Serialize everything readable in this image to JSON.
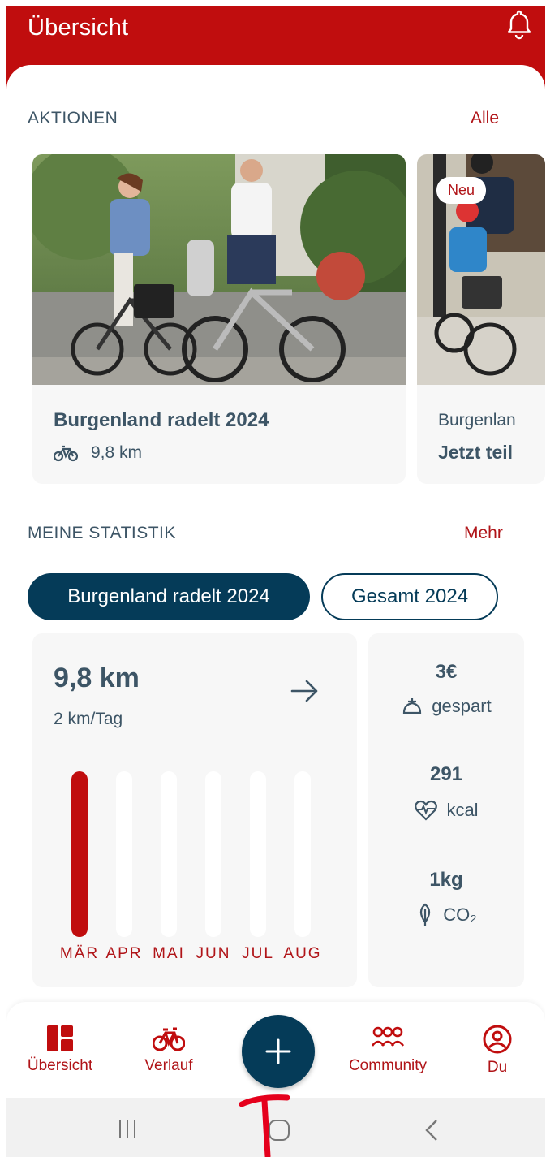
{
  "header": {
    "title": "Übersicht"
  },
  "actions": {
    "title": "AKTIONEN",
    "link": "Alle",
    "cards": [
      {
        "title": "Burgenland radelt 2024",
        "distance": "9,8 km"
      },
      {
        "badge": "Neu",
        "title": "Burgenlan",
        "subtitle": "Jetzt teil"
      }
    ]
  },
  "stats": {
    "title": "MEINE STATISTIK",
    "link": "Mehr",
    "tabs": [
      "Burgenland radelt 2024",
      "Gesamt 2024"
    ],
    "active_tab": 0,
    "total": "9,8 km",
    "per_day": "2 km/Tag",
    "months": [
      "MÄR",
      "APR",
      "MAI",
      "JUN",
      "JUL",
      "AUG"
    ],
    "month_fractions": [
      1.0,
      0.0,
      0.0,
      0.0,
      0.0,
      0.0
    ],
    "side": [
      {
        "value": "3€",
        "label": "gespart",
        "icon": "piggy-icon"
      },
      {
        "value": "291",
        "label": "kcal",
        "icon": "heartbeat-icon"
      },
      {
        "value": "1kg",
        "label": "CO₂",
        "icon": "leaf-icon"
      }
    ]
  },
  "nav": {
    "items": [
      {
        "label": "Übersicht",
        "icon": "dashboard-icon"
      },
      {
        "label": "Verlauf",
        "icon": "bike-icon"
      },
      {
        "label": "Community",
        "icon": "people-icon"
      },
      {
        "label": "Du",
        "icon": "profile-icon"
      }
    ],
    "fab_icon": "plus-icon"
  },
  "colors": {
    "brand_red": "#c00d0e",
    "navy": "#053b58",
    "text": "#3d5566"
  }
}
